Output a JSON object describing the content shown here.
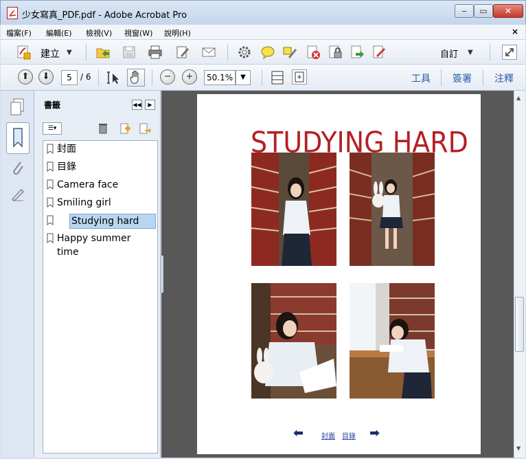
{
  "window": {
    "title": "少女寫真_PDF.pdf - Adobe Acrobat Pro",
    "min": "‒",
    "max": "▭",
    "close": "✕"
  },
  "menu": {
    "items": [
      "檔案(F)",
      "編輯(E)",
      "檢視(V)",
      "視窗(W)",
      "說明(H)"
    ],
    "close": "×"
  },
  "toolbar1": {
    "create_label": "建立",
    "custom_label": "自訂"
  },
  "toolbar2": {
    "page_current": "5",
    "page_total": "/ 6",
    "zoom": "50.1%",
    "tools": "工具",
    "sign": "簽署",
    "comment": "注釋"
  },
  "panel": {
    "title": "書籤",
    "bookmarks": [
      "封面",
      "目錄",
      "Camera face",
      "Smiling girl",
      "Studying hard",
      "Happy summer time"
    ],
    "selected_index": 4
  },
  "document": {
    "heading": "STUDYING HARD",
    "nav_cover": "封面",
    "nav_toc": "目錄"
  },
  "colors": {
    "heading": "#b41f24",
    "accent_link": "#2b5ca8"
  }
}
